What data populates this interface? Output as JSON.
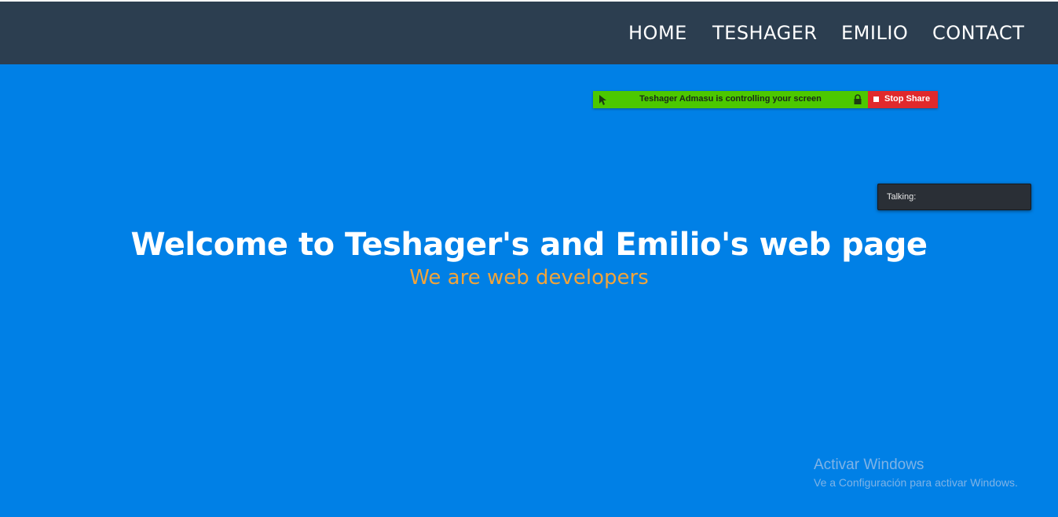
{
  "nav": {
    "items": [
      {
        "label": "HOME"
      },
      {
        "label": "TESHAGER"
      },
      {
        "label": "EMILIO"
      },
      {
        "label": "CONTACT"
      }
    ],
    "background": "#2c3e50"
  },
  "hero": {
    "title": "Welcome to Teshager's and Emilio's web page",
    "subtitle": "We are web developers",
    "background": "#0080e6",
    "subtitle_color": "#f0a43a"
  },
  "remote_control": {
    "status_text": "Teshager Admasu is controlling your screen",
    "stop_label": "Stop Share",
    "status_color": "#4cc800",
    "stop_color": "#e0292c",
    "icons": [
      "control-arrow-icon",
      "lock-icon",
      "stop-square-icon"
    ]
  },
  "talking_panel": {
    "label": "Talking:"
  },
  "windows_activation": {
    "title": "Activar Windows",
    "message": "Ve a Configuración para activar Windows."
  }
}
